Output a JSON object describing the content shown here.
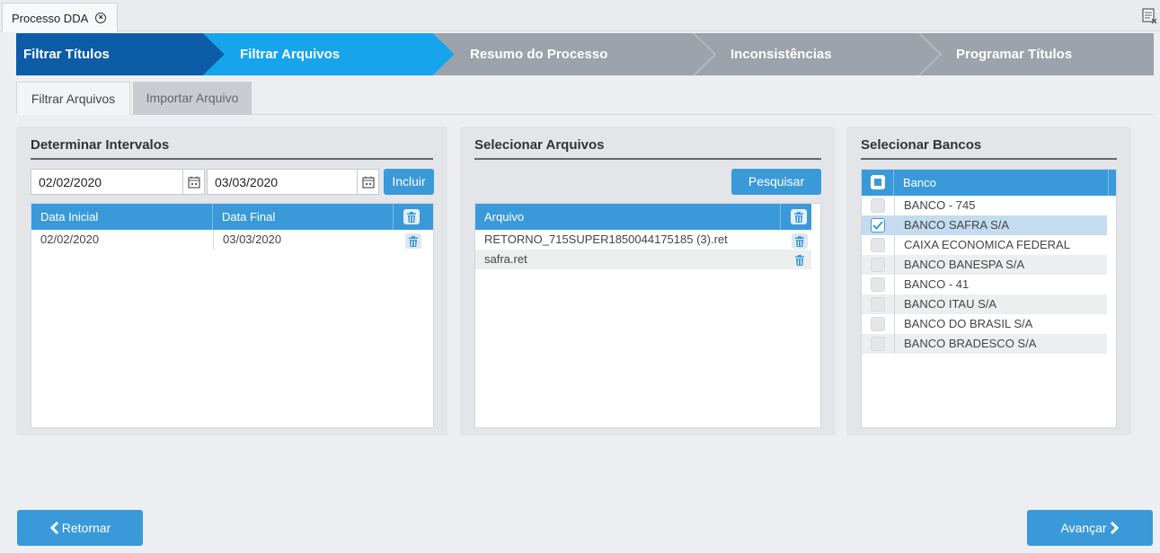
{
  "tab": {
    "title": "Processo DDA"
  },
  "wizard": {
    "steps": [
      {
        "label": "Filtrar Títulos"
      },
      {
        "label": "Filtrar Arquivos"
      },
      {
        "label": "Resumo do Processo"
      },
      {
        "label": "Inconsistências"
      },
      {
        "label": "Programar Títulos"
      }
    ],
    "colors": {
      "done": "#0d5ca8",
      "active": "#16a5ec",
      "pending": "#9ca3ab"
    }
  },
  "subtabs": [
    {
      "label": "Filtrar Arquivos"
    },
    {
      "label": "Importar Arquivo"
    }
  ],
  "intervals": {
    "title": "Determinar Intervalos",
    "start_value": "02/02/2020",
    "end_value": "03/03/2020",
    "add_label": "Incluir",
    "columns": [
      "Data Inicial",
      "Data Final"
    ],
    "rows": [
      {
        "start": "02/02/2020",
        "end": "03/03/2020"
      }
    ]
  },
  "files": {
    "title": "Selecionar Arquivos",
    "search_label": "Pesquisar",
    "column": "Arquivo",
    "rows": [
      {
        "name": "RETORNO_715SUPER1850044175185 (3).ret"
      },
      {
        "name": "safra.ret"
      }
    ]
  },
  "banks": {
    "title": "Selecionar Bancos",
    "column": "Banco",
    "rows": [
      {
        "name": "BANCO - 745"
      },
      {
        "name": "BANCO SAFRA S/A"
      },
      {
        "name": "CAIXA ECONOMICA FEDERAL"
      },
      {
        "name": "BANCO BANESPA S/A"
      },
      {
        "name": "BANCO - 41"
      },
      {
        "name": "BANCO ITAU S/A"
      },
      {
        "name": "BANCO DO BRASIL S/A"
      },
      {
        "name": "BANCO BRADESCO S/A"
      }
    ],
    "selected": "BANCO SAFRA S/A"
  },
  "footer": {
    "back_label": "Retornar",
    "next_label": "Avançar"
  }
}
